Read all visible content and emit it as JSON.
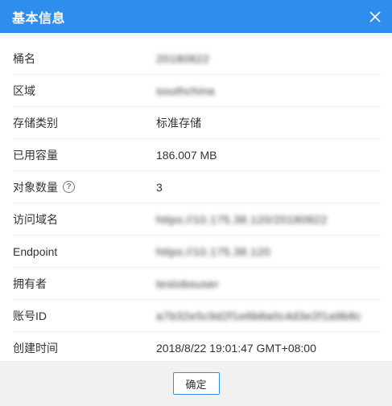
{
  "dialog": {
    "title": "基本信息",
    "ok_label": "确定"
  },
  "fields": {
    "bucket_name": {
      "label": "桶名",
      "value": "20180822"
    },
    "region": {
      "label": "区域",
      "value": "southchina"
    },
    "storage_class": {
      "label": "存储类别",
      "value": "标准存储"
    },
    "used_capacity": {
      "label": "已用容量",
      "value": "186.007 MB"
    },
    "object_count": {
      "label": "对象数量",
      "value": "3"
    },
    "access_domain": {
      "label": "访问域名",
      "value": "https://10.175.38.120/20180822"
    },
    "endpoint": {
      "label": "Endpoint",
      "value": "https://10.175.38.120"
    },
    "owner": {
      "label": "拥有者",
      "value": "testobsuser"
    },
    "account_id": {
      "label": "账号ID",
      "value": "a7b32e5c9d2f1e6b8a0c4d3e2f1a9b8c"
    },
    "created_time": {
      "label": "创建时间",
      "value": "2018/8/22 19:01:47 GMT+08:00"
    }
  }
}
